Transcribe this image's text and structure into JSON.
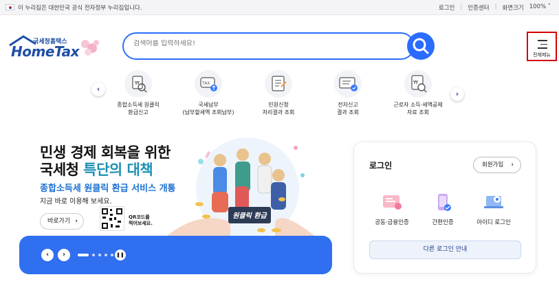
{
  "topbar": {
    "gov_notice": "이 누리집은 대한민국 공식 전자정부 누리집입니다.",
    "login": "로그인",
    "cert_center": "인증센터",
    "zoom_label": "화면크기",
    "zoom_value": "100%"
  },
  "logo": {
    "sub": "국세청홈택스",
    "main": "HomeTax"
  },
  "search": {
    "placeholder": "검색어를 입력하세요!"
  },
  "menu": {
    "label": "전체메뉴"
  },
  "quick_menu": [
    {
      "label": "종합소득세 원클릭\n환급신고",
      "icon": "document-search-icon"
    },
    {
      "label": "국세납부\n(납부할세액 조회납부)",
      "icon": "tax-payment-icon"
    },
    {
      "label": "민원신청\n처리결과 조회",
      "icon": "checklist-icon"
    },
    {
      "label": "전자신고\n결과 조회",
      "icon": "monitor-check-icon"
    },
    {
      "label": "근로자 소득·세액공제\n자료 조회",
      "icon": "document-magnifier-icon"
    }
  ],
  "hero": {
    "line1": "민생 경제 회복을 위한",
    "line2_prefix": "국세청 ",
    "line2_highlight": "특단의 대책",
    "line3": "종합소득세 원클릭 환급 서비스 개통",
    "line4": "지금 바로 이용해 보세요.",
    "button": "바로가기",
    "qr_label": "QR코드를\n찍어보세요.",
    "sign_text": "원클릭 환급"
  },
  "login_card": {
    "title": "로그인",
    "signup": "회원가입",
    "options": [
      {
        "label": "공동·금융인증",
        "icon": "certificate-icon"
      },
      {
        "label": "간편인증",
        "icon": "phone-auth-icon"
      },
      {
        "label": "아이디 로그인",
        "icon": "laptop-login-icon"
      }
    ],
    "other_login": "다른 로그인 안내"
  },
  "colors": {
    "accent": "#2b6cff",
    "brand": "#1f4ea3",
    "banner": "#2f6ff0",
    "highlight": "#1b8fb5"
  }
}
